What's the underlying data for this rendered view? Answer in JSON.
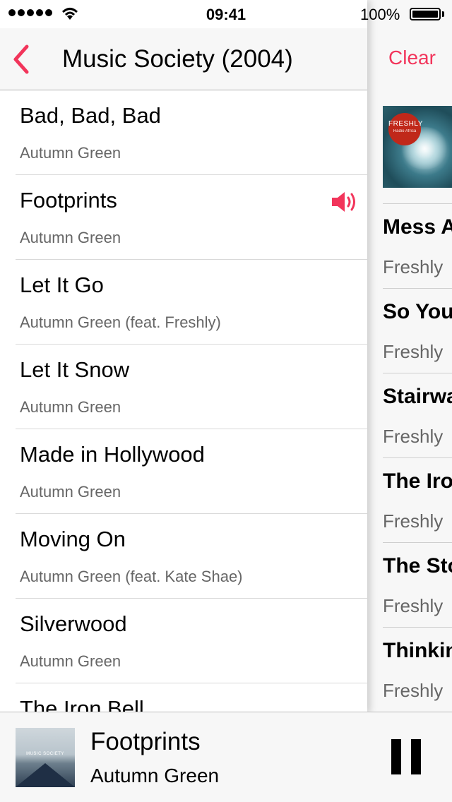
{
  "status_bar": {
    "time": "09:41",
    "battery": "100%"
  },
  "nav": {
    "title": "Music Society (2004)",
    "back_icon": "chevron-left-icon"
  },
  "tracks": [
    {
      "title": "Bad, Bad, Bad",
      "artist": "Autumn Green"
    },
    {
      "title": "Footprints",
      "artist": "Autumn Green",
      "playing": true
    },
    {
      "title": "Let It Go",
      "artist": "Autumn Green (feat. Freshly)"
    },
    {
      "title": "Let It Snow",
      "artist": "Autumn Green"
    },
    {
      "title": "Made in Hollywood",
      "artist": "Autumn Green"
    },
    {
      "title": "Moving On",
      "artist": "Autumn Green (feat. Kate Shae)"
    },
    {
      "title": "Silverwood",
      "artist": "Autumn Green"
    },
    {
      "title": "The Iron Bell",
      "artist": ""
    }
  ],
  "queue": {
    "clear_label": "Clear",
    "album_badge": {
      "top": "FRESHLY",
      "sub": "Radio Africa"
    },
    "items": [
      {
        "title": "Mess A",
        "artist": "Freshly"
      },
      {
        "title": "So You",
        "artist": "Freshly"
      },
      {
        "title": "Stairwa",
        "artist": "Freshly"
      },
      {
        "title": "The Iro",
        "artist": "Freshly"
      },
      {
        "title": "The Sto",
        "artist": "Freshly"
      },
      {
        "title": "Thinkin",
        "artist": "Freshly"
      }
    ]
  },
  "now_playing": {
    "title": "Footprints",
    "artist": "Autumn Green",
    "art_text": "MUSIC SOCIETY",
    "pause_icon": "pause-icon"
  },
  "colors": {
    "accent": "#f2355b",
    "secondary_text": "#666666"
  }
}
